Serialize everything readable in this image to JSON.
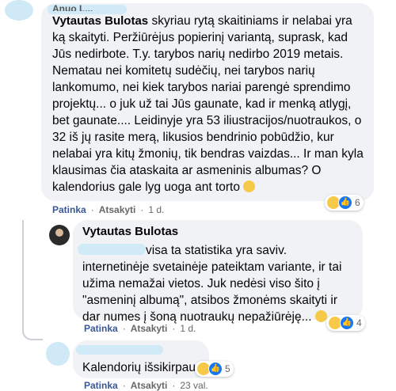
{
  "comment1": {
    "header_partial": "Anuo L...",
    "name": "Vytautas Bulotas",
    "text": "skyriau rytą skaitiniams ir nelabai yra ką skaityti. Peržiūrėjus popierinį variantą, suprask, kad Jūs nedirbote. T.y. tarybos narių nedirbo 2019 metais. Nematau nei komitetų sudėčių, nei tarybos narių lankomumo, nei kiek tarybos nariai parengė sprendimo projektų... o juk už tai Jūs gaunate, kad ir menką atlygį, bet gaunate.... Leidinyje yra 53 iliustracijos/nuotraukos, o 32 iš jų rasite merą, likusios bendrinio pobūdžio, kur nelabai yra kitų žmonių, tik bendras vaizdas... Ir man kyla klausimas čia ataskaita ar asmeninis albumas? O kalendorius gale lyg uoga ant torto",
    "like": "Patinka",
    "reply": "Atsakyti",
    "time": "1 d.",
    "reaction_count": "6"
  },
  "comment2": {
    "name": "Vytautas Bulotas",
    "text": "visa ta statistika yra saviv. internetinėje svetainėje pateiktam variante, ir tai užima nemažai vietos. Juk nedėsi viso šito į \"asmeninį albumą\", atsibos žmonėms skaityti ir dar numes į šoną nuotraukų nepažiūrėję...",
    "like": "Patinka",
    "reply": "Atsakyti",
    "time": "1 d.",
    "reaction_count": "4"
  },
  "comment3": {
    "text": "Kalendorių išsikirpau.",
    "like": "Patinka",
    "reply": "Atsakyti",
    "time": "23 val.",
    "reaction_count": "5"
  },
  "separator": "·",
  "colors": {
    "bubble": "#f0f2f5",
    "link": "#385898",
    "meta": "#65676b",
    "scribble": "#cfe9f7"
  }
}
